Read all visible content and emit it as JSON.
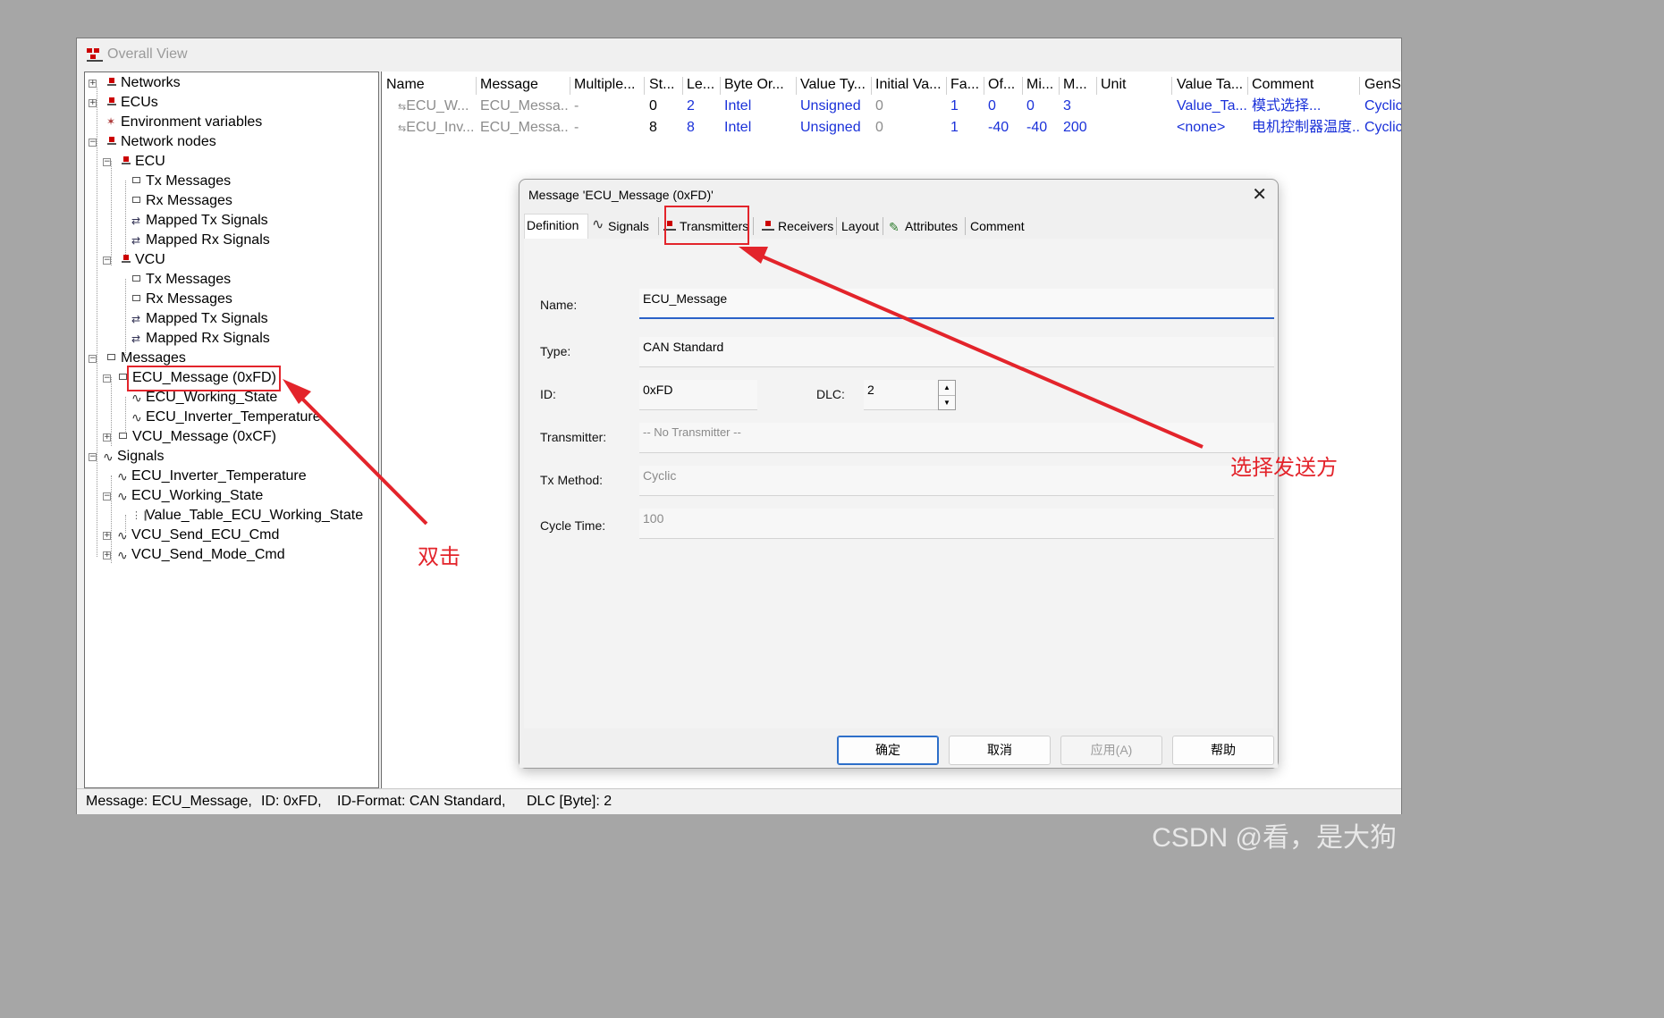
{
  "window": {
    "title": "Overall View"
  },
  "tree": {
    "items": [
      {
        "label": "Networks"
      },
      {
        "label": "ECUs"
      },
      {
        "label": "Environment variables"
      },
      {
        "label": "Network nodes"
      },
      {
        "label": "ECU"
      },
      {
        "label": "Tx Messages"
      },
      {
        "label": "Rx Messages"
      },
      {
        "label": "Mapped Tx Signals"
      },
      {
        "label": "Mapped Rx Signals"
      },
      {
        "label": "VCU"
      },
      {
        "label": "Tx Messages"
      },
      {
        "label": "Rx Messages"
      },
      {
        "label": "Mapped Tx Signals"
      },
      {
        "label": "Mapped Rx Signals"
      },
      {
        "label": "Messages"
      },
      {
        "label": "ECU_Message (0xFD)"
      },
      {
        "label": "ECU_Working_State"
      },
      {
        "label": "ECU_Inverter_Temperature"
      },
      {
        "label": "VCU_Message (0xCF)"
      },
      {
        "label": "Signals"
      },
      {
        "label": "ECU_Inverter_Temperature"
      },
      {
        "label": "ECU_Working_State"
      },
      {
        "label": "Value_Table_ECU_Working_State"
      },
      {
        "label": "VCU_Send_ECU_Cmd"
      },
      {
        "label": "VCU_Send_Mode_Cmd"
      }
    ]
  },
  "grid": {
    "columns": [
      "Name",
      "Message",
      "Multiple...",
      "St...",
      "Le...",
      "Byte Or...",
      "Value Ty...",
      "Initial Va...",
      "Fa...",
      "Of...",
      "Mi...",
      "M...",
      "Unit",
      "Value Ta...",
      "Comment",
      "GenSi"
    ],
    "rows": [
      [
        "ECU_W...",
        "ECU_Messa...",
        "-",
        "0",
        "2",
        "Intel",
        "Unsigned",
        "0",
        "1",
        "0",
        "0",
        "3",
        "",
        "Value_Ta...",
        "模式选择...",
        "Cyclic"
      ],
      [
        "ECU_Inv...",
        "ECU_Messa...",
        "-",
        "8",
        "8",
        "Intel",
        "Unsigned",
        "0",
        "1",
        "-40",
        "-40",
        "200",
        "",
        "<none>",
        "电机控制器温度...",
        "Cyclic"
      ]
    ]
  },
  "status": {
    "message": "Message: ECU_Message,",
    "id": "ID: 0xFD,",
    "format": "ID-Format: CAN Standard,",
    "dlc": "DLC [Byte]: 2"
  },
  "dialog": {
    "title": "Message 'ECU_Message (0xFD)'",
    "close_glyph": "✕",
    "tabs": [
      "Definition",
      "Signals",
      "Transmitters",
      "Receivers",
      "Layout",
      "Attributes",
      "Comment"
    ],
    "fields": {
      "name_label": "Name:",
      "name_value": "ECU_Message",
      "type_label": "Type:",
      "type_value": "CAN Standard",
      "id_label": "ID:",
      "id_value": "0xFD",
      "dlc_label": "DLC:",
      "dlc_value": "2",
      "transmitter_label": "Transmitter:",
      "transmitter_value": "-- No Transmitter --",
      "txmethod_label": "Tx Method:",
      "txmethod_value": "Cyclic",
      "cycletime_label": "Cycle Time:",
      "cycletime_value": "100"
    },
    "buttons": {
      "ok": "确定",
      "cancel": "取消",
      "apply": "应用(A)",
      "help": "帮助"
    }
  },
  "annotations": {
    "double_click": "双击",
    "select_transmitter": "选择发送方",
    "color": "#e3242b"
  },
  "watermark": "CSDN @看，是大狗"
}
